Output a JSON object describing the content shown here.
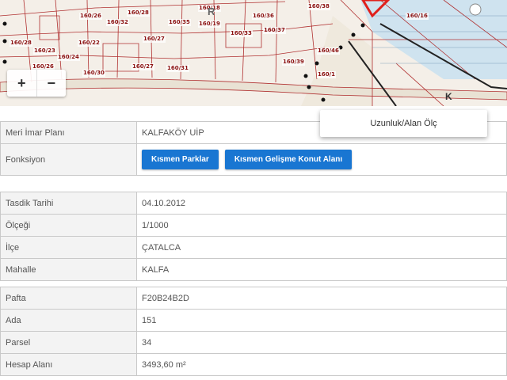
{
  "map": {
    "zoom_in_label": "+",
    "zoom_out_label": "−",
    "parcel_labels": [
      "160/26",
      "160/28",
      "160/36",
      "160/32",
      "160/35",
      "160/19",
      "160/33",
      "160/37",
      "160/27",
      "160/38",
      "160/28",
      "160/22",
      "160/23",
      "160/24",
      "160/27",
      "160/26",
      "160/30",
      "160/31",
      "160/39",
      "160/1",
      "160/46",
      "160/16",
      "160/18"
    ],
    "sheet_labels": [
      "R",
      "K"
    ]
  },
  "context_menu": {
    "item": "Uzunluk/Alan Ölç"
  },
  "plan_table": {
    "rows": [
      {
        "label": "Meri İmar Planı",
        "value": "KALFAKÖY UİP"
      },
      {
        "label": "Fonksiyon",
        "value": ""
      }
    ],
    "function_buttons": [
      "Kısmen Parklar",
      "Kısmen Gelişme Konut Alanı"
    ]
  },
  "date_table": {
    "rows": [
      {
        "label": "Tasdik Tarihi",
        "value": "04.10.2012"
      },
      {
        "label": "Ölçeği",
        "value": "1/1000"
      },
      {
        "label": "İlçe",
        "value": "ÇATALCA"
      },
      {
        "label": "Mahalle",
        "value": "KALFA"
      }
    ]
  },
  "parcel_table": {
    "rows": [
      {
        "label": "Pafta",
        "value": "F20B24B2D"
      },
      {
        "label": "Ada",
        "value": "151"
      },
      {
        "label": "Parsel",
        "value": "34"
      },
      {
        "label": "Hesap Alanı",
        "value": "3493,60 m²"
      }
    ]
  },
  "colors": {
    "button_blue": "#1976d2",
    "parcel_line": "#b03030",
    "highlight_red": "#e0201c",
    "water": "#cfe3ef"
  }
}
